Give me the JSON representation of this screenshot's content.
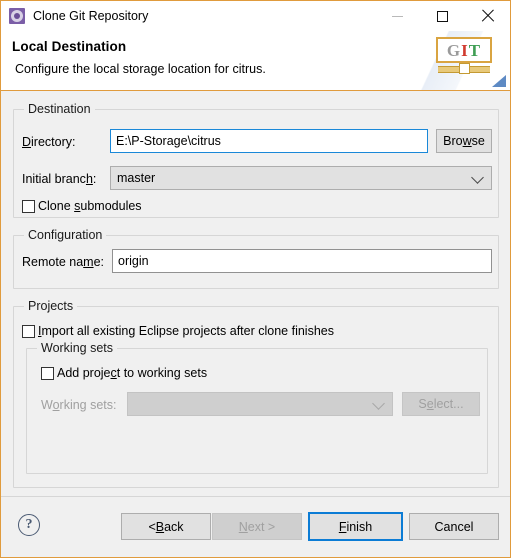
{
  "window": {
    "title": "Clone Git Repository",
    "icon": "git-repository-icon",
    "controls": {
      "minimize": "minimize-icon",
      "maximize": "maximize-icon",
      "close": "close-icon"
    },
    "border_color": "#e09b3d"
  },
  "header": {
    "title": "Local Destination",
    "description": "Configure the local storage location for citrus.",
    "logo": {
      "g": "G",
      "i": "I",
      "t": "T",
      "g_color": "#9a9a9a",
      "i_color": "#d03b2f",
      "t_color": "#3f9e54",
      "frame_color": "#d9a441"
    }
  },
  "destination": {
    "group_label": "Destination",
    "directory_label_pre": "D",
    "directory_label_post": "irectory:",
    "directory_value": "E:\\P-Storage\\citrus",
    "browse_label_pre": "Bro",
    "browse_label_mn": "w",
    "browse_label_post": "se",
    "initial_branch_label_pre": "Initial branc",
    "initial_branch_label_mn": "h",
    "initial_branch_label_post": ":",
    "initial_branch_value": "master",
    "clone_submodules_pre": "Clone ",
    "clone_submodules_mn": "s",
    "clone_submodules_post": "ubmodules",
    "clone_submodules_checked": false
  },
  "configuration": {
    "group_label": "Configuration",
    "remote_name_label_pre": "Remote na",
    "remote_name_label_mn": "m",
    "remote_name_label_post": "e:",
    "remote_name_value": "origin"
  },
  "projects": {
    "group_label": "Projects",
    "import_label_mn": "I",
    "import_label_post": "mport all existing Eclipse projects after clone finishes",
    "import_checked": false,
    "working_sets": {
      "group_label": "Working sets",
      "add_project_pre": "Add proje",
      "add_project_mn": "c",
      "add_project_post": "t to working sets",
      "add_project_checked": false,
      "working_sets_label_pre": "W",
      "working_sets_label_mn": "o",
      "working_sets_label_post": "rking sets:",
      "working_sets_value": "",
      "select_label_pre": "S",
      "select_label_mn": "e",
      "select_label_post": "lect...",
      "disabled": true
    }
  },
  "footer": {
    "help_glyph": "?",
    "buttons": {
      "back_pre": "< ",
      "back_mn": "B",
      "back_post": "ack",
      "next_pre": "",
      "next_mn": "N",
      "next_post": "ext >",
      "next_disabled": true,
      "finish_mn": "F",
      "finish_post": "inish",
      "finish_default": true,
      "cancel_label": "Cancel"
    }
  }
}
